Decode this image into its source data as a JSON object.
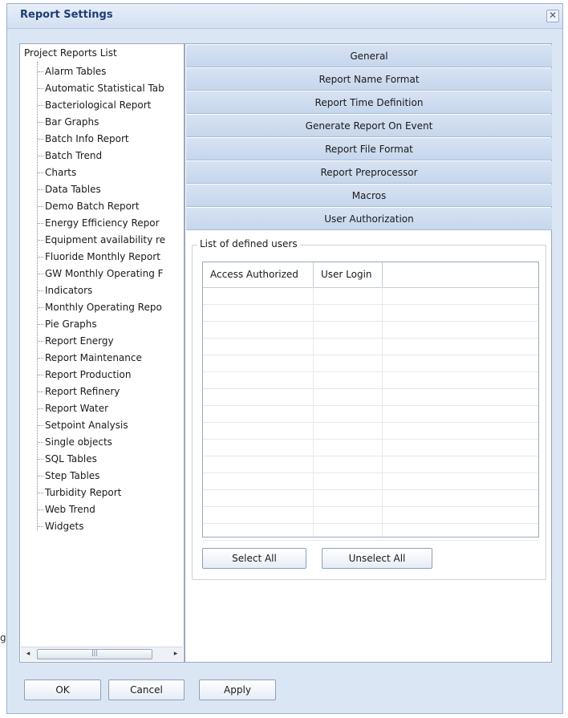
{
  "window": {
    "title": "Report Settings",
    "close_glyph": "✕"
  },
  "tree": {
    "root_label": "Project Reports List",
    "items": [
      "Alarm Tables",
      "Automatic Statistical Tab",
      "Bacteriological Report",
      "Bar Graphs",
      "Batch Info Report",
      "Batch Trend",
      "Charts",
      "Data Tables",
      "Demo Batch Report",
      "Energy Efficiency Repor",
      "Equipment availability re",
      "Fluoride Monthly Report",
      "GW Monthly Operating F",
      "Indicators",
      "Monthly Operating Repo",
      "Pie Graphs",
      "Report Energy",
      "Report Maintenance",
      "Report Production",
      "Report Refinery",
      "Report Water",
      "Setpoint Analysis",
      "Single objects",
      "SQL Tables",
      "Step Tables",
      "Turbidity Report",
      "Web Trend",
      "Widgets"
    ],
    "scroll": {
      "left": "◂",
      "right": "▸",
      "thumb_grip": "|||"
    }
  },
  "sections": [
    "General",
    "Report Name Format",
    "Report Time Definition",
    "Generate Report On Event",
    "Report File Format",
    "Report Preprocessor",
    "Macros",
    "User Authorization"
  ],
  "users": {
    "group_title": "List of defined users",
    "columns": [
      "Access Authorized",
      "User Login"
    ],
    "select_all_label": "Select All",
    "unselect_all_label": "Unselect All"
  },
  "footer": {
    "ok_label": "OK",
    "cancel_label": "Cancel",
    "apply_label": "Apply"
  },
  "stray_char": "g",
  "colors": {
    "title_text": "#1f3d74",
    "section_header": "#c6d6ec",
    "window_bg": "#dbe6f4"
  }
}
